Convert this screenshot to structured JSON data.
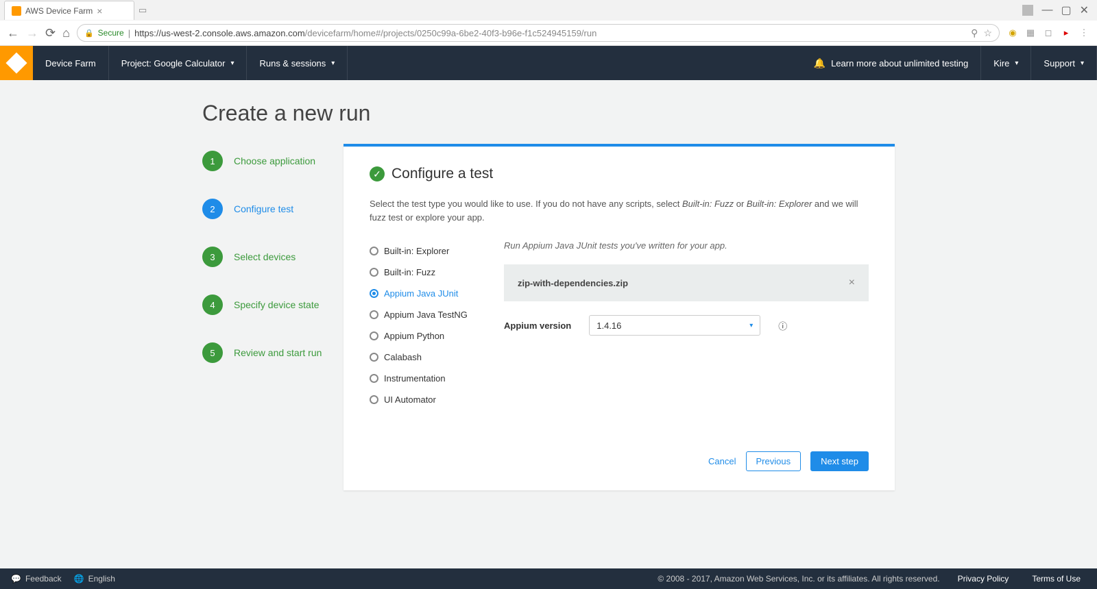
{
  "browser": {
    "tab_title": "AWS Device Farm",
    "secure_label": "Secure",
    "url_host": "https://us-west-2.console.aws.amazon.com",
    "url_path": "/devicefarm/home#/projects/0250c99a-6be2-40f3-b96e-f1c524945159/run"
  },
  "nav": {
    "service": "Device Farm",
    "project": "Project: Google Calculator",
    "runs": "Runs & sessions",
    "learn_more": "Learn more about unlimited testing",
    "user": "Kire",
    "support": "Support"
  },
  "page": {
    "title": "Create a new run"
  },
  "steps": [
    {
      "num": "1",
      "label": "Choose application",
      "active": false
    },
    {
      "num": "2",
      "label": "Configure test",
      "active": true
    },
    {
      "num": "3",
      "label": "Select devices",
      "active": false
    },
    {
      "num": "4",
      "label": "Specify device state",
      "active": false
    },
    {
      "num": "5",
      "label": "Review and start run",
      "active": false
    }
  ],
  "panel": {
    "title": "Configure a test",
    "desc_pre": "Select the test type you would like to use. If you do not have any scripts, select ",
    "desc_em1": "Built-in: Fuzz",
    "desc_mid": " or ",
    "desc_em2": "Built-in: Explorer",
    "desc_post": " and we will fuzz test or explore your app."
  },
  "test_types": [
    {
      "label": "Built-in: Explorer",
      "selected": false
    },
    {
      "label": "Built-in: Fuzz",
      "selected": false
    },
    {
      "label": "Appium Java JUnit",
      "selected": true
    },
    {
      "label": "Appium Java TestNG",
      "selected": false
    },
    {
      "label": "Appium Python",
      "selected": false
    },
    {
      "label": "Calabash",
      "selected": false
    },
    {
      "label": "Instrumentation",
      "selected": false
    },
    {
      "label": "UI Automator",
      "selected": false
    }
  ],
  "detail": {
    "hint": "Run Appium Java JUnit tests you've written for your app.",
    "file_name": "zip-with-dependencies.zip",
    "version_label": "Appium version",
    "version_value": "1.4.16"
  },
  "actions": {
    "cancel": "Cancel",
    "previous": "Previous",
    "next": "Next step"
  },
  "footer": {
    "feedback": "Feedback",
    "language": "English",
    "copyright": "© 2008 - 2017, Amazon Web Services, Inc. or its affiliates. All rights reserved.",
    "privacy": "Privacy Policy",
    "terms": "Terms of Use"
  }
}
